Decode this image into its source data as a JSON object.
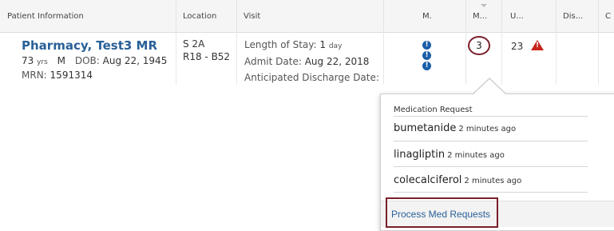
{
  "columns": {
    "patient_info": "Patient Information",
    "location": "Location",
    "visit": "Visit",
    "m1": "M.",
    "m2": "M...",
    "u": "U...",
    "dis": "Dis...",
    "extra": "C"
  },
  "patient": {
    "name": "Pharmacy, Test3 MR",
    "age": "73",
    "age_unit": "yrs",
    "sex": "M",
    "dob_label": "DOB:",
    "dob": "Aug 22, 1945",
    "mrn_label": "MRN:",
    "mrn": "1591314"
  },
  "location": {
    "unit": "S 2A",
    "room": "R18 - B52"
  },
  "visit": {
    "los_label": "Length of Stay:",
    "los_value": "1",
    "los_unit": "day",
    "admit_label": "Admit Date:",
    "admit_date": "Aug 22, 2018",
    "discharge_label": "Anticipated Discharge Date:"
  },
  "indicators": {
    "info_icon_glyph": "!",
    "med_request_count": "3",
    "u_count": "23",
    "warn_glyph": "!"
  },
  "popup": {
    "title": "Medication Request",
    "items": [
      {
        "name": "bumetanide",
        "ago": "2 minutes ago"
      },
      {
        "name": "linagliptin",
        "ago": "2 minutes ago"
      },
      {
        "name": "colecalciferol",
        "ago": "2 minutes ago"
      }
    ],
    "action_label": "Process Med Requests"
  },
  "colors": {
    "link_blue": "#2a6099",
    "highlight_border": "#7a1f2b",
    "info_icon": "#1a5ea8",
    "warning_red": "#c8231b"
  }
}
